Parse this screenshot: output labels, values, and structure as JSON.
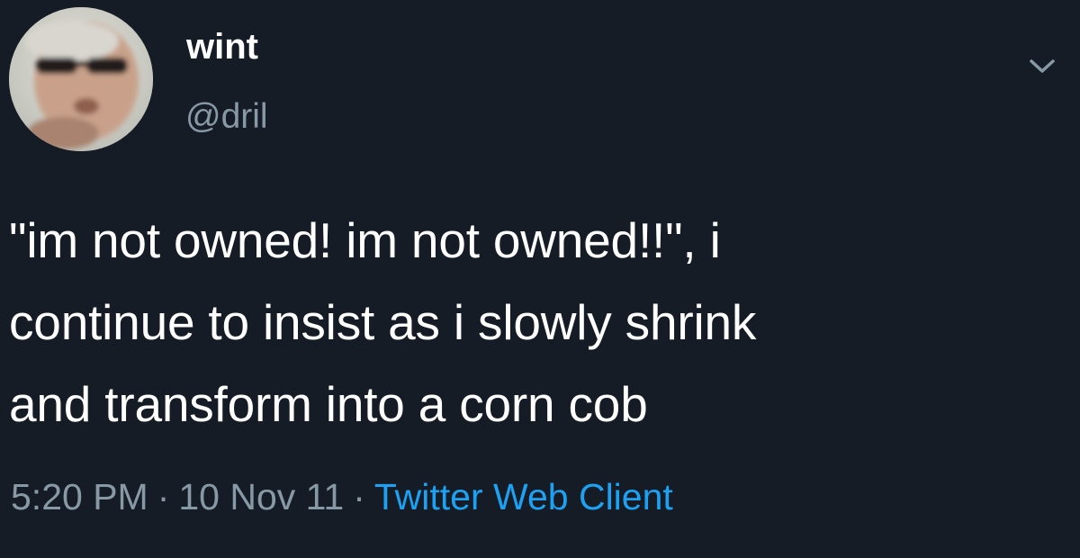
{
  "tweet": {
    "author": {
      "display_name": "wint",
      "handle": "@dril",
      "avatar_icon": "profile-photo"
    },
    "menu_icon": "chevron-down-icon",
    "text_lines": [
      "\"im not owned!  im not owned!!\", i",
      "continue to insist as i slowly shrink",
      "and transform into a corn cob"
    ],
    "time": "5:20 PM",
    "date": "10 Nov 11",
    "separator": "·",
    "client": "Twitter Web Client"
  },
  "colors": {
    "background": "#151c26",
    "text": "#ffffff",
    "secondary": "#8899a6",
    "link": "#1da1f2"
  }
}
